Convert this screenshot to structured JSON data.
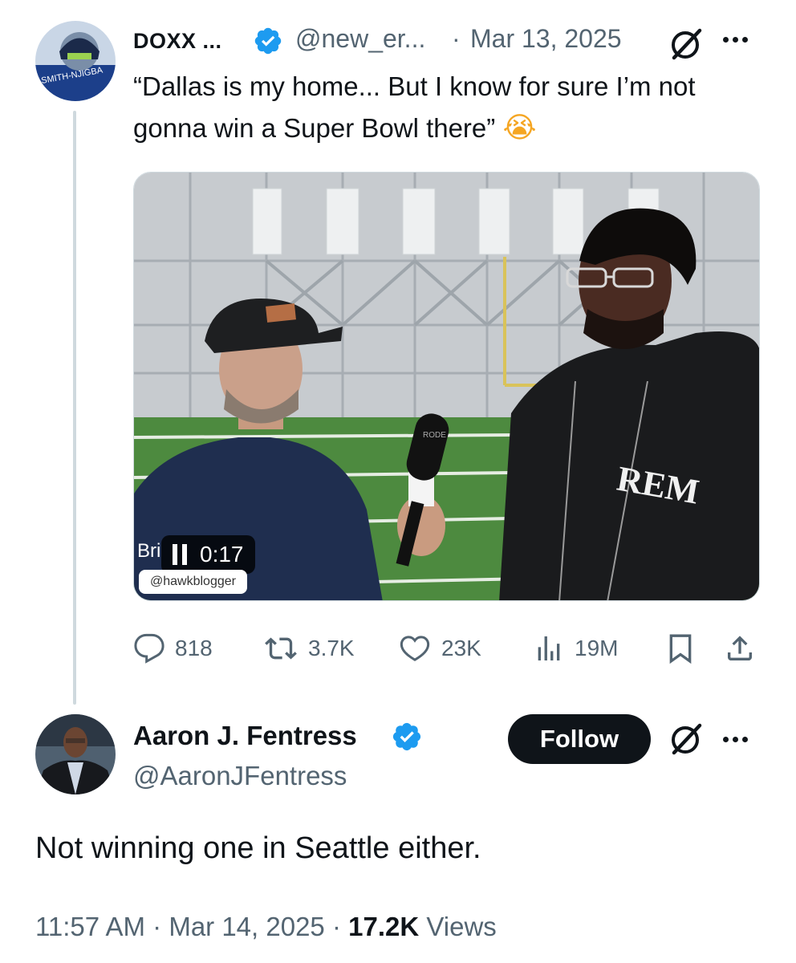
{
  "parent": {
    "display_name": "DOXX ...",
    "handle": "@new_er...",
    "separator": "·",
    "date": "Mar 13, 2025",
    "text": "“Dallas is my home... But I know for sure I’m not gonna win a Super Bowl there”",
    "emoji": "😭",
    "media": {
      "timestamp": "0:17",
      "overlay_name_partial": "Bri",
      "source_tag": "@hawkblogger",
      "mic_logo": "RODE",
      "hoodie_text": "REM"
    },
    "stats": {
      "replies": "818",
      "reposts": "3.7K",
      "likes": "23K",
      "views": "19M"
    }
  },
  "reply": {
    "display_name": "Aaron J. Fentress",
    "handle": "@AaronJFentress",
    "follow_label": "Follow",
    "text": "Not winning one in Seattle either.",
    "time": "11:57 AM",
    "separator": "·",
    "date": "Mar 14, 2025",
    "views_count": "17.2K",
    "views_label": "Views"
  },
  "colors": {
    "verified": "#1d9bf0",
    "secondary_text": "#536471",
    "primary_text": "#0f1419",
    "thread_line": "#cfd9de"
  }
}
